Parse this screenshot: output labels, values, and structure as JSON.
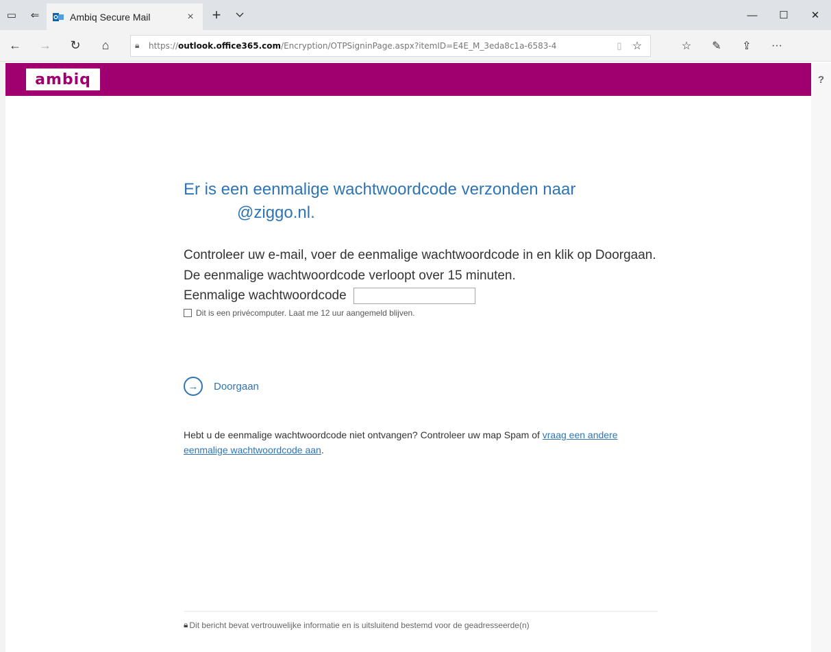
{
  "browser": {
    "tab_title": "Ambiq Secure Mail",
    "url_prefix": "https://",
    "url_host": "outlook.office365.com",
    "url_path": "/Encryption/OTPSigninPage.aspx?itemID=E4E_M_3eda8c1a-6583-4",
    "icons": {
      "tabs_aside": "set-aside-tabs-icon",
      "tab_preview": "tab-preview-icon",
      "tab_favicon": "outlook-icon",
      "tab_close": "close-icon",
      "new_tab": "plus-icon",
      "tab_dropdown": "chevron-down-icon",
      "minimize": "minimize-icon",
      "maximize": "maximize-icon",
      "close_window": "close-icon",
      "back": "back-arrow-icon",
      "forward": "forward-arrow-icon",
      "refresh": "refresh-icon",
      "home": "home-icon",
      "lock": "lock-icon",
      "reading_view": "reading-view-icon",
      "favorite": "star-icon",
      "favorites_list": "favorites-icon",
      "notes": "pen-icon",
      "share": "share-icon",
      "more": "more-icon"
    }
  },
  "brand": {
    "logo_text": "ambiq",
    "color": "#a0006f",
    "help_label": "?"
  },
  "main": {
    "heading_line1": "Er is een eenmalige wachtwoordcode verzonden naar",
    "heading_email": "@ziggo.nl.",
    "instructions": "Controleer uw e-mail, voer de eenmalige wachtwoordcode in en klik op Doorgaan. De eenmalige wachtwoordcode verloopt over 15 minuten.",
    "otp_label": "Eenmalige wachtwoordcode",
    "otp_value": "",
    "remember_label": "Dit is een privécomputer. Laat me 12 uur aangemeld blijven.",
    "continue_label": "Doorgaan",
    "resend_text": "Hebt u de eenmalige wachtwoordcode niet ontvangen? Controleer uw map Spam of ",
    "resend_link": "vraag een andere eenmalige wachtwoordcode aan",
    "resend_end": ".",
    "accent_color": "#2e74b5"
  },
  "footer": {
    "text": "Dit bericht bevat vertrouwelijke informatie en is uitsluitend bestemd voor de geadresseerde(n)"
  }
}
